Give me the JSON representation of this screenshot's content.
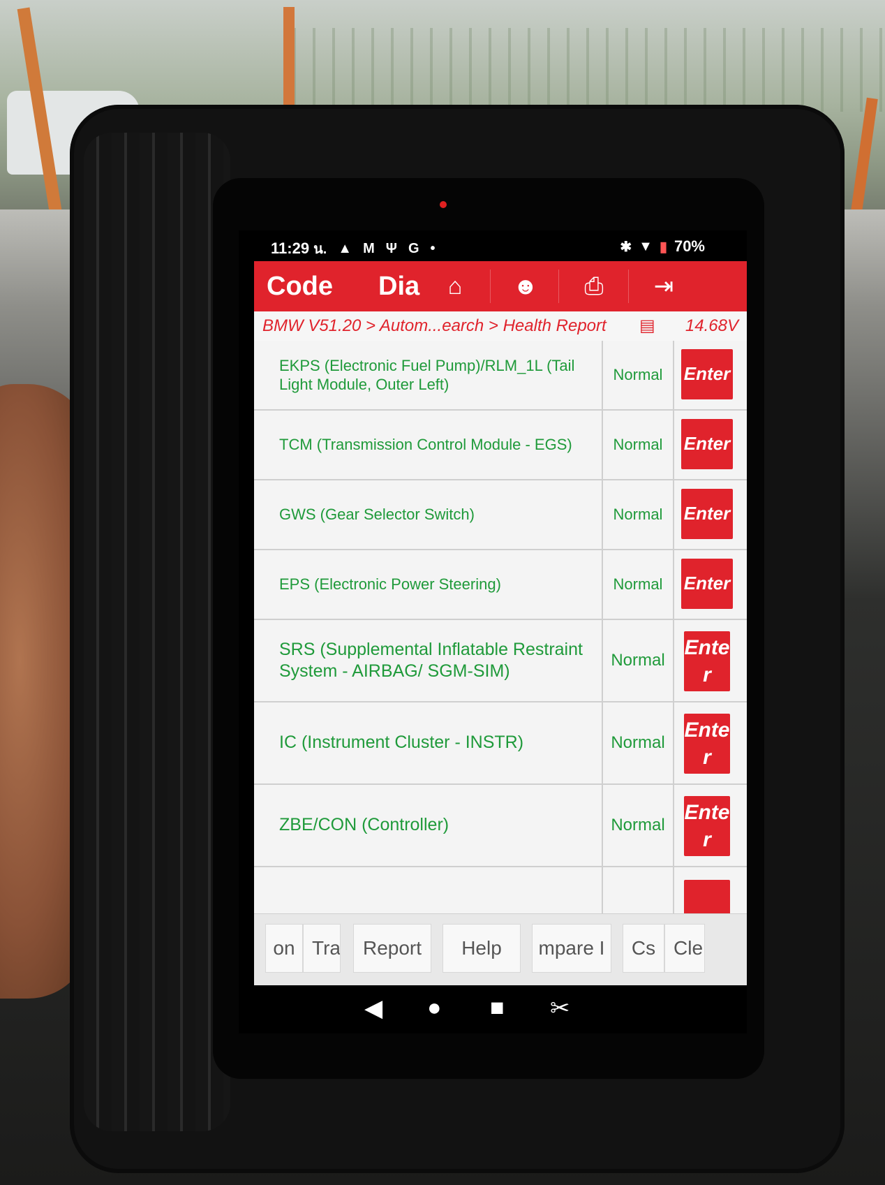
{
  "status_bar": {
    "time": "11:29",
    "carrier_glyph": "น.",
    "left_icons": [
      "warning-icon",
      "gmail-icon",
      "usb-icon",
      "google-icon",
      "dot-icon"
    ],
    "battery": "70%",
    "right_icons": [
      "bluetooth-icon",
      "wifi-icon",
      "battery-icon"
    ]
  },
  "topbar": {
    "code_label": "Code",
    "dia_label": "Dia",
    "icons": [
      "home-icon",
      "user-icon",
      "print-icon",
      "exit-icon"
    ]
  },
  "breadcrumb": {
    "path": "BMW V51.20 > Autom...earch > Health Report",
    "voltage": "14.68V"
  },
  "modules": [
    {
      "name": "EKPS (Electronic Fuel Pump)/RLM_1L (Tail Light Module, Outer Left)",
      "status": "Normal",
      "button": "Enter"
    },
    {
      "name": "TCM (Transmission Control Module - EGS)",
      "status": "Normal",
      "button": "Enter"
    },
    {
      "name": "GWS (Gear Selector Switch)",
      "status": "Normal",
      "button": "Enter"
    },
    {
      "name": "EPS (Electronic Power Steering)",
      "status": "Normal",
      "button": "Enter"
    },
    {
      "name": "SRS (Supplemental Inflatable Restraint System - AIRBAG/ SGM-SIM)",
      "status": "Normal",
      "button": "Enter"
    },
    {
      "name": "IC (Instrument Cluster - INSTR)",
      "status": "Normal",
      "button": "Enter"
    },
    {
      "name": "ZBE/CON (Controller)",
      "status": "Normal",
      "button": "Enter"
    }
  ],
  "bottom_buttons": [
    "on",
    "Tra",
    "Report",
    "Help",
    "mpare I",
    "Cs",
    "Cle"
  ],
  "nav": [
    "back-icon",
    "home-circle-icon",
    "recents-icon",
    "screenshot-icon"
  ],
  "colors": {
    "accent": "#e0232c",
    "text_ok": "#1f9a3a"
  }
}
